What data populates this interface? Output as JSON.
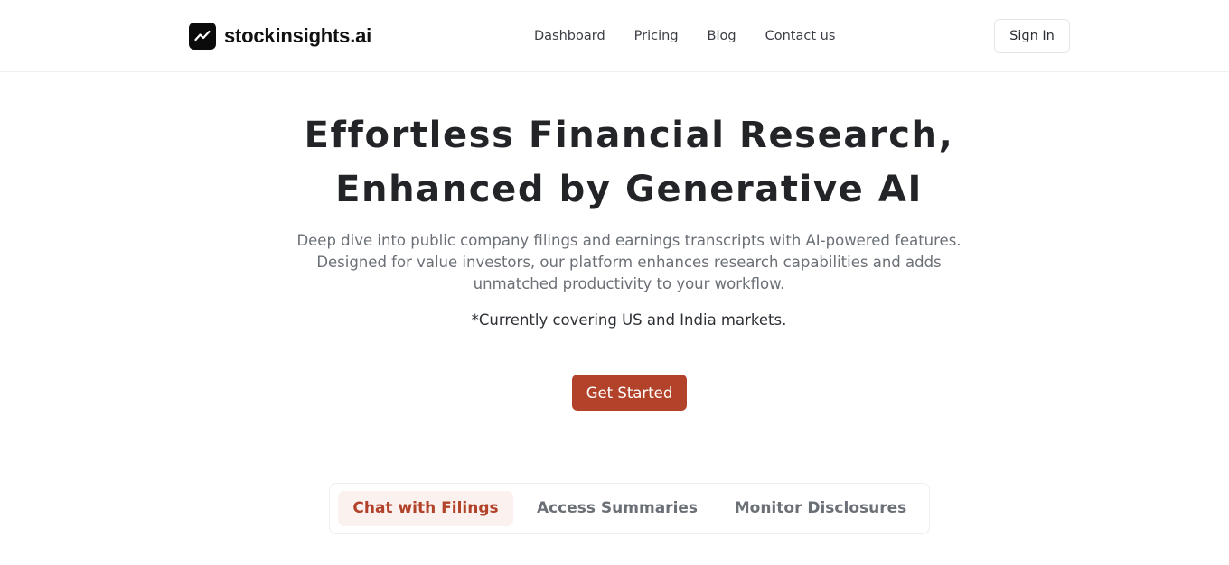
{
  "brand": {
    "name": "stockinsights.ai",
    "logo_icon": "trending-chart-icon"
  },
  "nav": {
    "items": [
      {
        "label": "Dashboard"
      },
      {
        "label": "Pricing"
      },
      {
        "label": "Blog"
      },
      {
        "label": "Contact us"
      }
    ],
    "signin_label": "Sign In"
  },
  "hero": {
    "title_line1": "Effortless Financial Research,",
    "title_line2": "Enhanced by Generative AI",
    "description_line1": "Deep dive into public company filings and earnings transcripts with AI-powered features.",
    "description_line2": "Designed for value investors, our platform enhances research capabilities and adds",
    "description_line3": "unmatched productivity to your workflow.",
    "note": "*Currently covering US and India markets.",
    "cta_label": "Get Started"
  },
  "tabs": {
    "items": [
      {
        "label": "Chat with Filings",
        "active": true
      },
      {
        "label": "Access Summaries",
        "active": false
      },
      {
        "label": "Monitor Disclosures",
        "active": false
      }
    ]
  },
  "colors": {
    "accent": "#b2432a",
    "accent_soft": "#fbf1ee",
    "logo_bg": "#0b0b0b",
    "text_muted": "#6b7077"
  }
}
